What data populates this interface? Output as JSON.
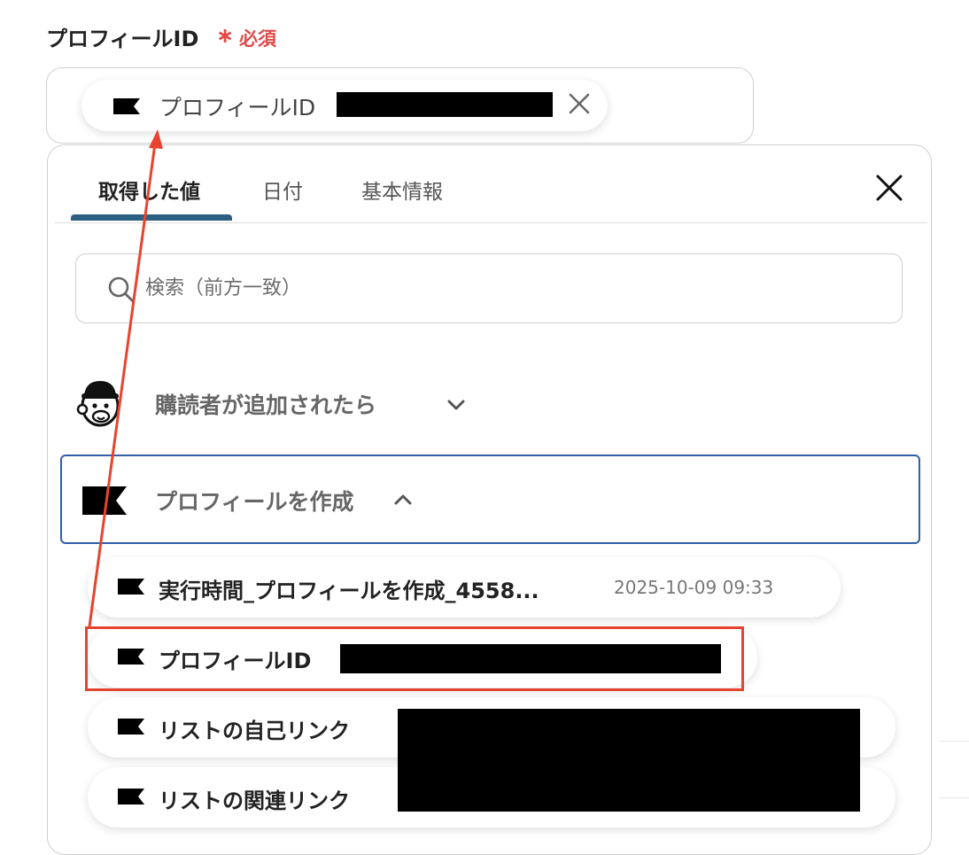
{
  "field": {
    "label": "プロフィールID",
    "required_mark": "∗",
    "required_text": "必須"
  },
  "selected_chip": {
    "label": "プロフィールID"
  },
  "tabs": [
    {
      "label": "取得した値",
      "active": true
    },
    {
      "label": "日付",
      "active": false
    },
    {
      "label": "基本情報",
      "active": false
    }
  ],
  "search": {
    "placeholder": "検索（前方一致）",
    "value": ""
  },
  "sections": [
    {
      "title": "購読者が追加されたら",
      "icon": "mailchimp-icon",
      "expanded": false
    },
    {
      "title": "プロフィールを作成",
      "icon": "klaviyo-flag-icon",
      "expanded": true
    }
  ],
  "items": [
    {
      "label": "実行時間_プロフィールを作成_4558...",
      "value": "2025-10-09 09:33"
    },
    {
      "label": "プロフィールID",
      "value": ""
    },
    {
      "label": "リストの自己リンク",
      "value": ""
    },
    {
      "label": "リストの関連リンク",
      "value": ""
    }
  ],
  "colors": {
    "accent": "#2c5f82",
    "section_border": "#2e5fa8",
    "required": "#e04a4a",
    "annotation": "#e8432e"
  }
}
